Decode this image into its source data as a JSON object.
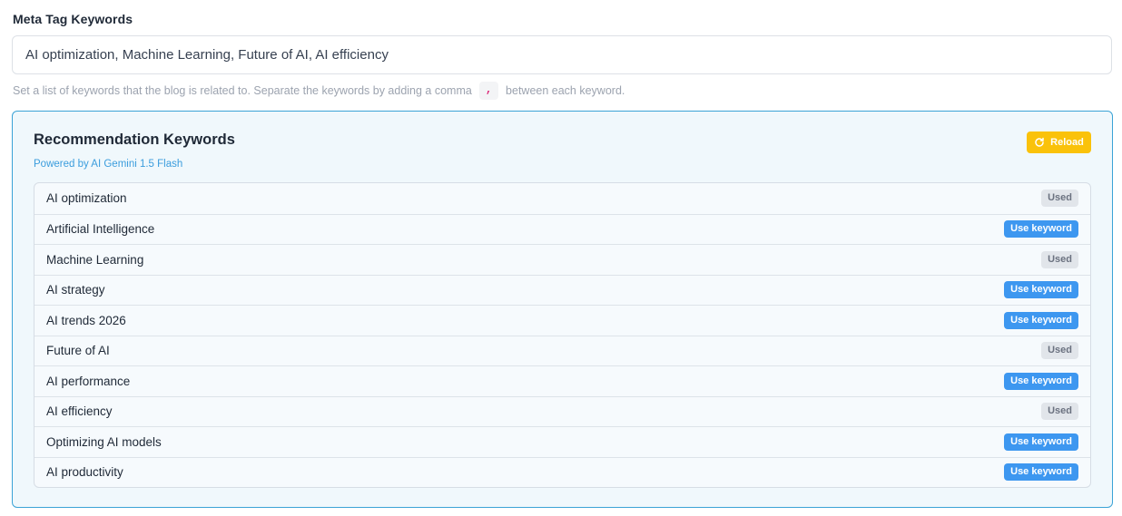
{
  "field": {
    "label": "Meta Tag Keywords",
    "value": "AI optimization, Machine Learning, Future of AI, AI efficiency",
    "help_before": "Set a list of keywords that the blog is related to. Separate the keywords by adding a comma",
    "help_chip": ",",
    "help_after": "between each keyword."
  },
  "recommendations": {
    "title": "Recommendation Keywords",
    "subtitle": "Powered by AI Gemini 1.5 Flash",
    "reload_label": "Reload",
    "reload_icon": "refresh-icon",
    "items": [
      {
        "keyword": "AI optimization",
        "status": "used",
        "action": "Used"
      },
      {
        "keyword": "Artificial Intelligence",
        "status": "available",
        "action": "Use keyword"
      },
      {
        "keyword": "Machine Learning",
        "status": "used",
        "action": "Used"
      },
      {
        "keyword": "AI strategy",
        "status": "available",
        "action": "Use keyword"
      },
      {
        "keyword": "AI trends 2026",
        "status": "available",
        "action": "Use keyword"
      },
      {
        "keyword": "Future of AI",
        "status": "used",
        "action": "Used"
      },
      {
        "keyword": "AI performance",
        "status": "available",
        "action": "Use keyword"
      },
      {
        "keyword": "AI efficiency",
        "status": "used",
        "action": "Used"
      },
      {
        "keyword": "Optimizing AI models",
        "status": "available",
        "action": "Use keyword"
      },
      {
        "keyword": "AI productivity",
        "status": "available",
        "action": "Use keyword"
      }
    ]
  },
  "colors": {
    "panel_border": "#3ba3d6",
    "panel_bg": "#f0f8fc",
    "reload_bg": "#fac20a",
    "use_keyword_bg": "#3d97f0",
    "used_bg": "#e1e5ea",
    "subtitle": "#3b9ddd"
  }
}
